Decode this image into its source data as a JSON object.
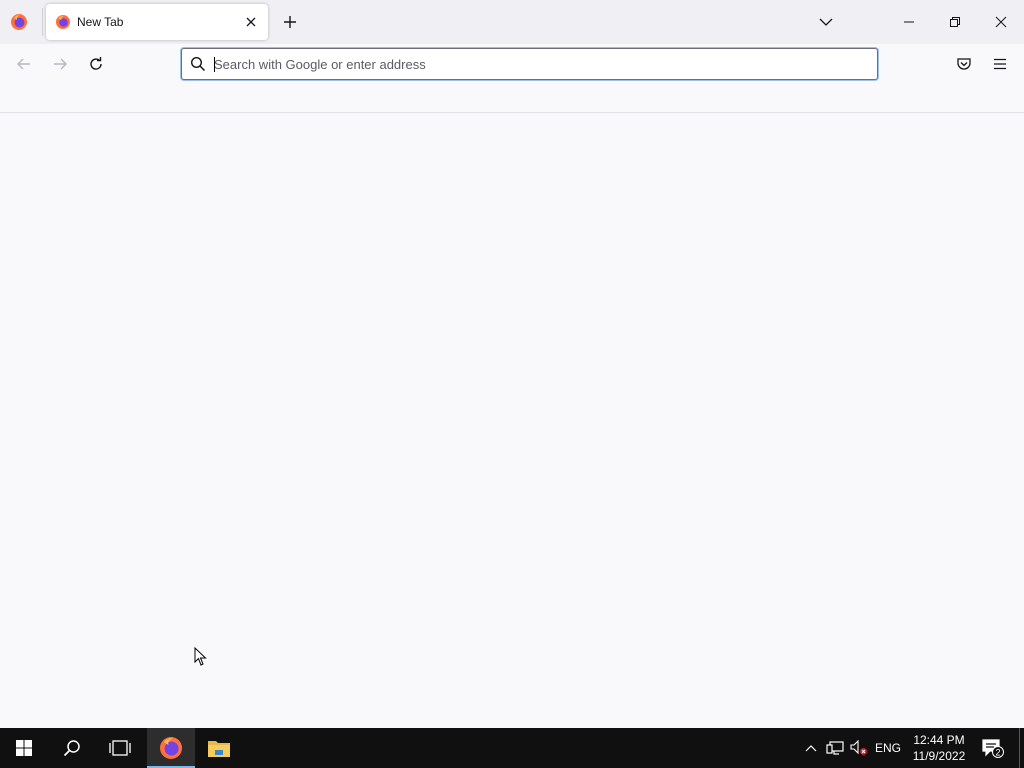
{
  "browser": {
    "tab": {
      "title": "New Tab"
    },
    "urlbar": {
      "placeholder": "Search with Google or enter address",
      "value": ""
    }
  },
  "taskbar": {
    "language": "ENG",
    "time": "12:44 PM",
    "date": "11/9/2022",
    "notification_count": "2"
  },
  "colors": {
    "accent_blue": "#0060df",
    "firefox_orange": "#ff7139",
    "firefox_purple": "#7542e5",
    "taskbar": "#101010",
    "active_indicator": "#76b9ed"
  }
}
